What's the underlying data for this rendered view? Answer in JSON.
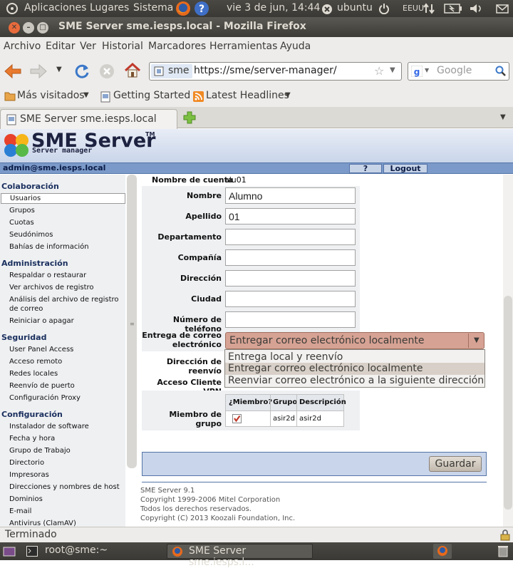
{
  "top_panel": {
    "menus": [
      "Aplicaciones",
      "Lugares",
      "Sistema"
    ],
    "datetime": "vie  3 de jun, 14:44",
    "user": "ubuntu",
    "keyboard": "EEUU"
  },
  "window": {
    "title": "SME Server sme.iesps.local - Mozilla Firefox"
  },
  "menubar": [
    "Archivo",
    "Editar",
    "Ver",
    "Historial",
    "Marcadores",
    "Herramientas",
    "Ayuda"
  ],
  "navbar": {
    "identity": "sme",
    "url": "https://sme/server-manager/",
    "search_placeholder": "Google"
  },
  "bookmarks": [
    "Más visitados",
    "Getting Started",
    "Latest Headlines"
  ],
  "tab": {
    "title": "SME Server sme.iesps.local"
  },
  "page": {
    "logo_title": "SME Server",
    "logo_tm": "TM",
    "logo_subtitle": "Server manager",
    "user": "admin@sme.iesps.local",
    "help_label": "?",
    "logout_label": "Logout",
    "sidebar": [
      {
        "section": "Colaboración",
        "items": [
          "Usuarios",
          "Grupos",
          "Cuotas",
          "Seudónimos",
          "Bahías de información"
        ]
      },
      {
        "section": "Administración",
        "items": [
          "Respaldar o restaurar",
          "Ver archivos de registro",
          "Análisis del archivo de registro de correo",
          "Reiniciar o apagar"
        ]
      },
      {
        "section": "Seguridad",
        "items": [
          "User Panel Access",
          "Acceso remoto",
          "Redes locales",
          "Reenvío de puerto",
          "Configuración Proxy"
        ]
      },
      {
        "section": "Configuración",
        "items": [
          "Instalador de software",
          "Fecha y hora",
          "Grupo de Trabajo",
          "Directorio",
          "Impresoras",
          "Direcciones y nombres de host",
          "Dominios",
          "E-mail",
          "Antivirus (ClamAV)"
        ]
      }
    ],
    "form": {
      "account_label": "Nombre de cuenta",
      "account_value": "alu01",
      "first_name_label": "Nombre",
      "first_name_value": "Alumno",
      "last_name_label": "Apellido",
      "last_name_value": "01",
      "department_label": "Departamento",
      "company_label": "Compañía",
      "address_label": "Dirección",
      "city_label": "Ciudad",
      "phone_label": "Número de teléfono",
      "delivery_label": "Entrega de correo electrónico",
      "delivery_selected": "Entregar correo electrónico localmente",
      "delivery_options": [
        "Entrega local y reenvío",
        "Entregar correo electrónico localmente",
        "Reenviar correo electrónico a la siguiente dirección"
      ],
      "forward_label": "Dirección de reenvío",
      "vpn_label": "Acceso Cliente VPN",
      "group_label": "Miembro de grupo",
      "group_table": {
        "headers": [
          "¿Miembro?",
          "Grupo",
          "Descripción"
        ],
        "rows": [
          {
            "member": true,
            "group": "asir2d",
            "description": "asir2d"
          }
        ]
      },
      "save_label": "Guardar"
    },
    "footer": [
      "SME Server 9.1",
      "Copyright 1999-2006 Mitel Corporation",
      "Todos los derechos reservados.",
      "Copyright (C) 2013 Koozali Foundation, Inc."
    ]
  },
  "status": "Terminado",
  "taskbar": {
    "items": [
      "root@sme:~",
      "SME Server sme.iesps.l..."
    ]
  },
  "colors": {
    "panel": "#3c3b37",
    "banner_blue": "#7b9ac9",
    "selected_option": "#d8d0c8",
    "select_bg": "#d6a294"
  }
}
